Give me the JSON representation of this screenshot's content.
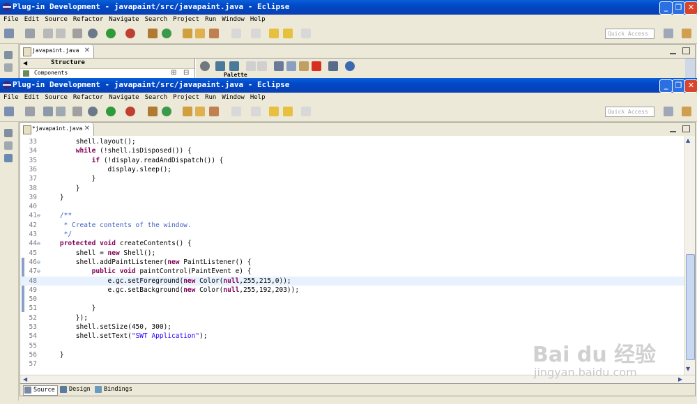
{
  "back_window": {
    "title": "Plug-in Development - javapaint/src/javapaint.java - Eclipse",
    "menu": [
      "File",
      "Edit",
      "Source",
      "Refactor",
      "Navigate",
      "Search",
      "Project",
      "Run",
      "Window",
      "Help"
    ],
    "quick_access": "Quick Access",
    "tab_label": "javapaint.java",
    "structure_label": "Structure",
    "components_label": "Components",
    "palette_label": "Palette"
  },
  "front_window": {
    "title": "Plug-in Development - javapaint/src/javapaint.java - Eclipse",
    "menu": [
      "File",
      "Edit",
      "Source",
      "Refactor",
      "Navigate",
      "Search",
      "Project",
      "Run",
      "Window",
      "Help"
    ],
    "quick_access": "Quick Access",
    "tab_label": "*javapaint.java",
    "bottom_tabs": [
      "Source",
      "Design",
      "Bindings"
    ],
    "code": [
      {
        "n": "33",
        "text": "        shell.layout();"
      },
      {
        "n": "34",
        "text": "        while (!shell.isDisposed()) {"
      },
      {
        "n": "35",
        "text": "            if (!display.readAndDispatch()) {"
      },
      {
        "n": "36",
        "text": "                display.sleep();"
      },
      {
        "n": "37",
        "text": "            }"
      },
      {
        "n": "38",
        "text": "        }"
      },
      {
        "n": "39",
        "text": "    }"
      },
      {
        "n": "40",
        "text": ""
      },
      {
        "n": "41",
        "text": "    /**"
      },
      {
        "n": "42",
        "text": "     * Create contents of the window."
      },
      {
        "n": "43",
        "text": "     */"
      },
      {
        "n": "44",
        "text": "    protected void createContents() {"
      },
      {
        "n": "45",
        "text": "        shell = new Shell();"
      },
      {
        "n": "46",
        "text": "        shell.addPaintListener(new PaintListener() {"
      },
      {
        "n": "47",
        "text": "            public void paintControl(PaintEvent e) {"
      },
      {
        "n": "48",
        "text": "                e.gc.setForeground(new Color(null,255,215,0));"
      },
      {
        "n": "49",
        "text": "                e.gc.setBackground(new Color(null,255,192,203));"
      },
      {
        "n": "50",
        "text": ""
      },
      {
        "n": "51",
        "text": "            }"
      },
      {
        "n": "52",
        "text": "        });"
      },
      {
        "n": "53",
        "text": "        shell.setSize(450, 300);"
      },
      {
        "n": "54",
        "text": "        shell.setText(\"SWT Application\");"
      },
      {
        "n": "55",
        "text": ""
      },
      {
        "n": "56",
        "text": "    }"
      },
      {
        "n": "57",
        "text": ""
      }
    ]
  },
  "watermark": {
    "brand": "Bai du 经验",
    "url": "jingyan.baidu.com"
  },
  "colors": {
    "title_bar": "#0a4fd0",
    "keyword": "#7f0055",
    "comment": "#3f5fbf",
    "string": "#2a00ff",
    "current_line": "#e8f2fe"
  }
}
